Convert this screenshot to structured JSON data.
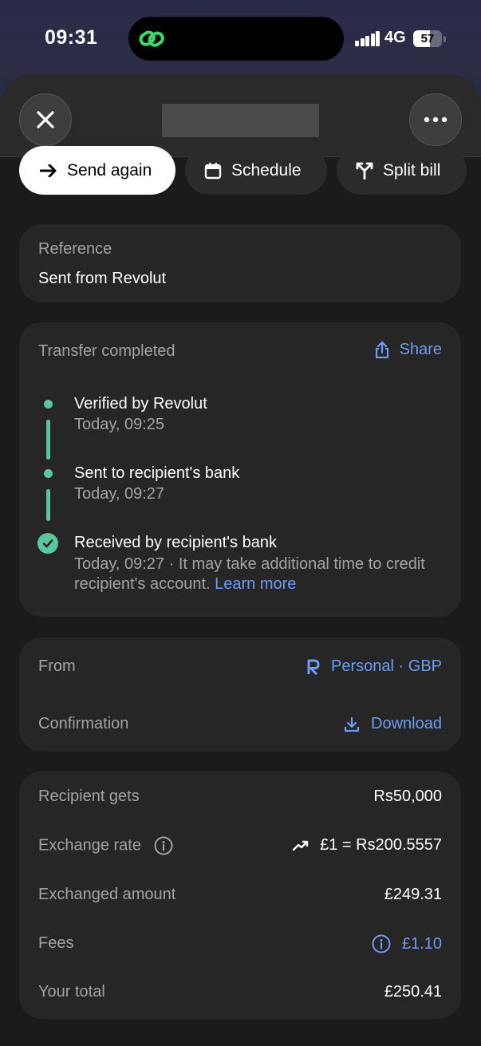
{
  "status_bar": {
    "time": "09:31",
    "network": "4G",
    "battery": "57",
    "battery_level_percent": 57
  },
  "header": {
    "close_icon": "close-icon",
    "more_icon": "more-icon"
  },
  "actions": {
    "send_again": "Send again",
    "schedule": "Schedule",
    "split_bill": "Split bill"
  },
  "reference": {
    "label": "Reference",
    "value": "Sent from Revolut"
  },
  "transfer": {
    "title": "Transfer completed",
    "share": "Share",
    "steps": [
      {
        "title": "Verified by Revolut",
        "time": "Today, 09:25"
      },
      {
        "title": "Sent to recipient's bank",
        "time": "Today, 09:27"
      },
      {
        "title": "Received by recipient's bank",
        "time": "Today, 09:27 · It may take additional time to credit recipient's account.",
        "link": "Learn more"
      }
    ],
    "accent_color": "#5cc59e"
  },
  "from": {
    "label": "From",
    "value": "Personal · GBP",
    "confirmation_label": "Confirmation",
    "download": "Download"
  },
  "details": {
    "recipient_gets_label": "Recipient gets",
    "recipient_gets_value": "Rs50,000",
    "exchange_rate_label": "Exchange rate",
    "exchange_rate_value": "£1 = Rs200.5557",
    "exchanged_amount_label": "Exchanged amount",
    "exchanged_amount_value": "£249.31",
    "fees_label": "Fees",
    "fees_value": "£1.10",
    "total_label": "Your total",
    "total_value": "£250.41"
  },
  "colors": {
    "accent_blue": "#6f9bf2",
    "success_green": "#5cc59e"
  }
}
